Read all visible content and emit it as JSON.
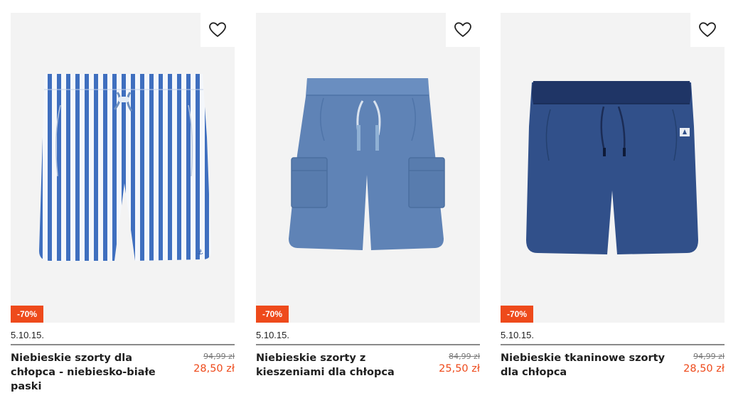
{
  "colors": {
    "accent": "#ee4a1b",
    "card_bg": "#f3f3f3"
  },
  "products": [
    {
      "image_icon": "striped-shorts-image",
      "favorite_icon": "heart-icon",
      "badge": "-70%",
      "brand": "5.10.15.",
      "name": "Niebieskie szorty dla chłopca - niebiesko-białe paski",
      "old_price": "94,99 zł",
      "new_price": "28,50 zł"
    },
    {
      "image_icon": "cargo-shorts-image",
      "favorite_icon": "heart-icon",
      "badge": "-70%",
      "brand": "5.10.15.",
      "name": "Niebieskie szorty z kieszeniami dla chłopca",
      "old_price": "84,99 zł",
      "new_price": "25,50 zł"
    },
    {
      "image_icon": "denim-shorts-image",
      "favorite_icon": "heart-icon",
      "badge": "-70%",
      "brand": "5.10.15.",
      "name": "Niebieskie tkaninowe szorty dla chłopca",
      "old_price": "94,99 zł",
      "new_price": "28,50 zł"
    }
  ]
}
